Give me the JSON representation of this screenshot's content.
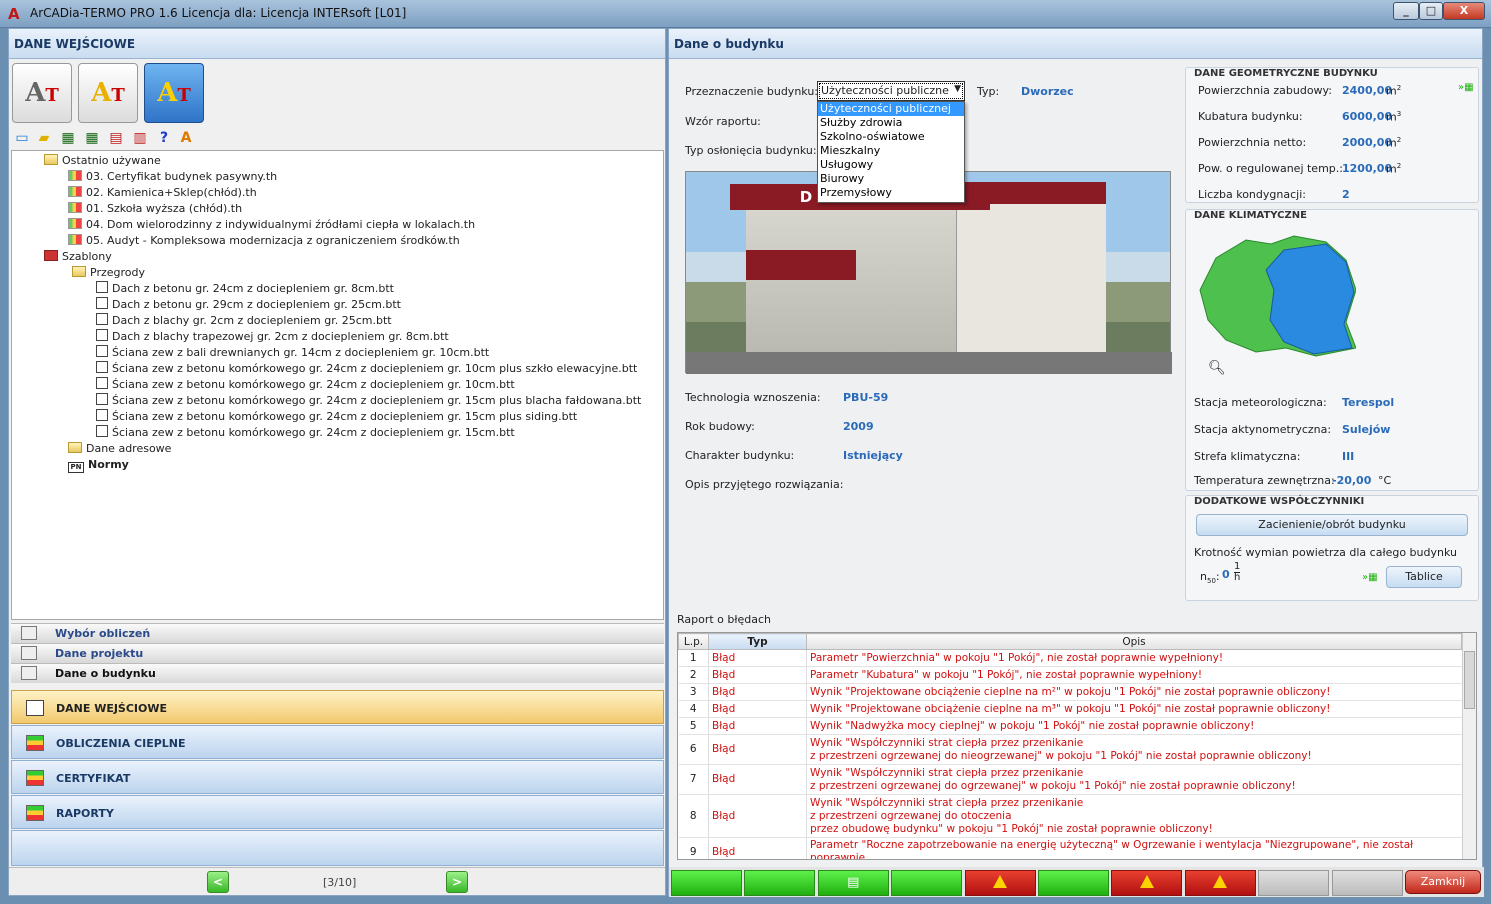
{
  "window": {
    "title": "ArCADia-TERMO PRO 1.6 Licencja dla: Licencja INTERsoft [L01]",
    "app_icon": "arcadia-logo-icon",
    "min": "_",
    "max": "□",
    "close": "X"
  },
  "left": {
    "header": "DANE WEJŚCIOWE",
    "big_buttons": [
      {
        "icon": "arcadia-termo-icon",
        "glyph": "AT"
      },
      {
        "icon": "arcadia-termo-plus-icon",
        "glyph": "AT"
      },
      {
        "icon": "arcadia-termo-pro-icon",
        "glyph": "AT"
      }
    ],
    "tree": [
      {
        "label": "Ostatnio używane",
        "icon": "folder"
      },
      {
        "label": "03. Certyfikat budynek pasywny.th",
        "icon": "file"
      },
      {
        "label": "02. Kamienica+Sklep(chłód).th",
        "icon": "file"
      },
      {
        "label": "01. Szkoła wyższa (chłód).th",
        "icon": "file"
      },
      {
        "label": "04. Dom wielorodzinny z indywidualnymi źródłami ciepła w lokalach.th",
        "icon": "file"
      },
      {
        "label": "05. Audyt - Kompleksowa modernizacja z ograniczeniem środków.th",
        "icon": "file"
      },
      {
        "label": "Szablony",
        "icon": "red"
      },
      {
        "label": "Przegrody",
        "icon": "folder"
      },
      {
        "label": "Dach z betonu gr. 24cm z dociepleniem gr. 8cm.btt",
        "icon": "btt"
      },
      {
        "label": "Dach z betonu gr. 29cm z dociepleniem gr. 25cm.btt",
        "icon": "btt"
      },
      {
        "label": "Dach z blachy gr. 2cm z dociepleniem gr. 25cm.btt",
        "icon": "btt"
      },
      {
        "label": "Dach z blachy trapezowej gr. 2cm z dociepleniem gr. 8cm.btt",
        "icon": "btt"
      },
      {
        "label": "Ściana zew z bali drewnianych gr. 14cm z dociepleniem gr. 10cm.btt",
        "icon": "btt"
      },
      {
        "label": "Ściana zew z betonu komórkowego gr. 24cm z dociepleniem gr. 10cm plus szkło elewacyjne.btt",
        "icon": "btt"
      },
      {
        "label": "Ściana zew z betonu komórkowego gr. 24cm z dociepleniem gr. 10cm.btt",
        "icon": "btt"
      },
      {
        "label": "Ściana zew z betonu komórkowego gr. 24cm z dociepleniem gr. 15cm plus blacha fałdowana.btt",
        "icon": "btt"
      },
      {
        "label": "Ściana zew z betonu komórkowego gr. 24cm z dociepleniem gr. 15cm plus siding.btt",
        "icon": "btt"
      },
      {
        "label": "Ściana zew z betonu komórkowego gr. 24cm z dociepleniem gr. 15cm.btt",
        "icon": "btt"
      },
      {
        "label": "Dane adresowe",
        "icon": "folder"
      },
      {
        "label": "Normy",
        "icon": "pn"
      }
    ],
    "nav": [
      {
        "label": "Wybór obliczeń",
        "icon": "ben-icon"
      },
      {
        "label": "Dane projektu",
        "icon": "pages-icon"
      },
      {
        "label": "Dane o budynku",
        "icon": "building-doc-icon"
      }
    ],
    "sections": [
      {
        "label": "DANE WEJŚCIOWE",
        "icon": "pencil-icon"
      },
      {
        "label": "OBLICZENIA CIEPLNE",
        "icon": "energy-bars-icon"
      },
      {
        "label": "CERTYFIKAT",
        "icon": "energy-bars-icon"
      },
      {
        "label": "RAPORTY",
        "icon": "energy-bars-icon"
      }
    ],
    "pager": {
      "prev": "<",
      "text": "[3/10]",
      "next": ">"
    }
  },
  "right": {
    "header": "Dane o budynku",
    "przeznaczenie_label": "Przeznaczenie budynku:",
    "przeznaczenie_value": "Użyteczności publiczne",
    "typ_label": "Typ:",
    "typ_value": "Dworzec",
    "wzor_label": "Wzór raportu:",
    "oslona_label": "Typ osłonięcia budynku:",
    "options": [
      "Użyteczności publicznej",
      "Służby zdrowia",
      "Szkolno-oświatowe",
      "Mieszkalny",
      "Usługowy",
      "Biurowy",
      "Przemysłowy"
    ],
    "building_sign": "DWORZEC",
    "technologia_label": "Technologia wznoszenia:",
    "technologia_value": "PBU-59",
    "rok_label": "Rok budowy:",
    "rok_value": "2009",
    "charakter_label": "Charakter budynku:",
    "charakter_value": "Istniejący",
    "opis_label": "Opis przyjętego rozwiązania:",
    "geo": {
      "title": "DANE GEOMETRYCZNE BUDYNKU",
      "rows": [
        {
          "label": "Powierzchnia zabudowy:",
          "value": "2400,00",
          "unit": "m",
          "sup": "2"
        },
        {
          "label": "Kubatura budynku:",
          "value": "6000,00",
          "unit": "m",
          "sup": "3"
        },
        {
          "label": "Powierzchnia netto:",
          "value": "2000,00",
          "unit": "m",
          "sup": "2"
        },
        {
          "label": "Pow. o regulowanej temp.:",
          "value": "1200,00",
          "unit": "m",
          "sup": "2"
        },
        {
          "label": "Liczba kondygnacji:",
          "value": "2",
          "unit": "",
          "sup": ""
        }
      ]
    },
    "klim": {
      "title": "DANE KLIMATYCZNE",
      "stacja_label": "Stacja meteorologiczna:",
      "stacja_value": "Terespol",
      "akt_label": "Stacja aktynometryczna:",
      "akt_value": "Sulejów",
      "strefa_label": "Strefa klimatyczna:",
      "strefa_value": "III",
      "temp_label": "Temperatura zewnętrzna:",
      "temp_value": "-20,00",
      "temp_unit": "°C"
    },
    "dodatkowe": {
      "title": "DODATKOWE WSPÓŁCZYNNIKI",
      "button": "Zacienienie/obrót budynku",
      "krotnosc": "Krotność wymian powietrza dla całego budynku",
      "n50_label": "n",
      "n50_sub": "50",
      "n50_value": "0",
      "n50_unit_num": "1",
      "n50_unit_den": "h",
      "tablice": "Tablice"
    },
    "report": {
      "title": "Raport o błędach",
      "headers": [
        "L.p.",
        "Typ",
        "Opis"
      ],
      "rows": [
        {
          "lp": "1",
          "typ": "Błąd",
          "opis": [
            "Parametr \"Powierzchnia\" w pokoju \"1 Pokój\", nie został poprawnie wypełniony!"
          ]
        },
        {
          "lp": "2",
          "typ": "Błąd",
          "opis": [
            "Parametr \"Kubatura\" w pokoju \"1 Pokój\", nie został poprawnie wypełniony!"
          ]
        },
        {
          "lp": "3",
          "typ": "Błąd",
          "opis": [
            "Wynik \"Projektowane obciążenie cieplne na m²\" w pokoju \"1 Pokój\" nie został poprawnie obliczony!"
          ]
        },
        {
          "lp": "4",
          "typ": "Błąd",
          "opis": [
            "Wynik \"Projektowane obciążenie cieplne na m³\" w pokoju \"1 Pokój\" nie został poprawnie obliczony!"
          ]
        },
        {
          "lp": "5",
          "typ": "Błąd",
          "opis": [
            "Wynik \"Nadwyżka mocy cieplnej\" w pokoju \"1 Pokój\" nie został poprawnie obliczony!"
          ]
        },
        {
          "lp": "6",
          "typ": "Błąd",
          "opis": [
            "Wynik \"Współczynniki strat ciepła przez przenikanie",
            "z przestrzeni ogrzewanej do nieogrzewanej\" w pokoju \"1 Pokój\" nie został poprawnie obliczony!"
          ]
        },
        {
          "lp": "7",
          "typ": "Błąd",
          "opis": [
            "Wynik \"Współczynniki strat ciepła przez przenikanie",
            "z przestrzeni ogrzewanej do ogrzewanej\" w pokoju \"1 Pokój\" nie został poprawnie obliczony!"
          ]
        },
        {
          "lp": "8",
          "typ": "Błąd",
          "opis": [
            "Wynik \"Współczynniki strat ciepła przez przenikanie",
            "z przestrzeni ogrzewanej do otoczenia",
            "przez obudowę budynku\" w pokoju \"1 Pokój\" nie został poprawnie obliczony!"
          ]
        },
        {
          "lp": "9",
          "typ": "Błąd",
          "opis": [
            "Parametr \"Roczne zapotrzebowanie na energię użyteczną\" w Ogrzewanie i wentylacja \"Niezgrupowane\", nie został poprawnie"
          ]
        }
      ]
    },
    "status": [
      {
        "kind": "green",
        "icon": ""
      },
      {
        "kind": "green",
        "icon": ""
      },
      {
        "kind": "green",
        "icon": "document-icon"
      },
      {
        "kind": "green",
        "icon": ""
      },
      {
        "kind": "red",
        "icon": "warning-icon"
      },
      {
        "kind": "green",
        "icon": ""
      },
      {
        "kind": "red",
        "icon": "warning-icon"
      },
      {
        "kind": "red",
        "icon": "warning-icon"
      },
      {
        "kind": "gray",
        "icon": ""
      },
      {
        "kind": "gray",
        "icon": ""
      }
    ],
    "zamknij": "Zamknij"
  }
}
